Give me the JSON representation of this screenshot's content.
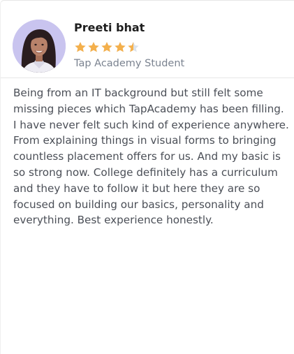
{
  "testimonial": {
    "reviewer": {
      "name": "Preeti bhat",
      "role": "Tap Academy Student",
      "avatar_icon": "student-avatar"
    },
    "rating": {
      "value": 4.5,
      "max": 5,
      "star_color": "#f4b04c",
      "empty_star_color": "#dbe2ea"
    },
    "review": "Being from an IT background but still felt some missing pieces which TapAcademy has been filling. I have never felt such kind of experience anywhere. From explaining things in visual forms to bringing countless placement offers for us. And my basic is so strong now. College definitely has a curriculum and they have to follow it but here they are so focused on building our basics, personality and everything. Best experience honestly."
  }
}
